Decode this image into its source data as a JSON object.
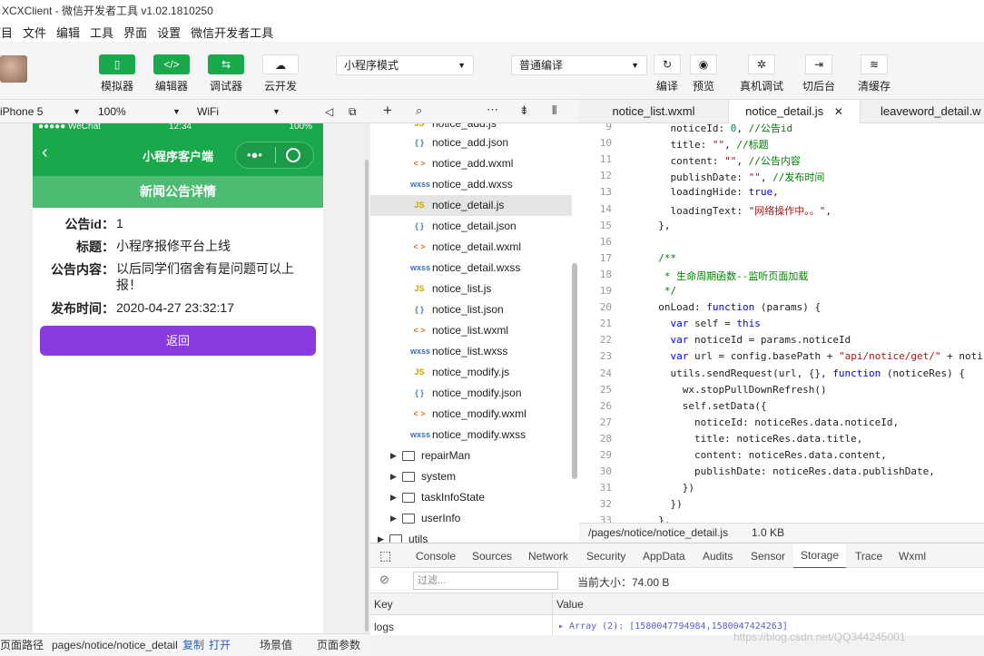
{
  "window": {
    "title": "XCXClient - 微信开发者工具 v1.02.1810250"
  },
  "menu": [
    "项目",
    "文件",
    "编辑",
    "工具",
    "界面",
    "设置",
    "微信开发者工具"
  ],
  "toolbar": {
    "simulator": "模拟器",
    "editor": "编辑器",
    "debugger": "调试器",
    "cloud": "云开发",
    "mode_select": "小程序模式",
    "compile_select": "普通编译",
    "compile": "编译",
    "preview": "预览",
    "remote_debug": "真机调试",
    "background": "切后台",
    "clear_cache": "清缓存"
  },
  "sim_bar": {
    "device": "iPhone 5",
    "zoom": "100%",
    "network": "WiFi"
  },
  "phone": {
    "status_left": "●●●●● WeChat",
    "status_time": "12:34",
    "status_right": "100%",
    "nav_title": "小程序客户端",
    "sub_title": "新闻公告详情",
    "fields": [
      {
        "k": "公告id：",
        "v": "1"
      },
      {
        "k": "标题：",
        "v": "小程序报修平台上线"
      },
      {
        "k": "公告内容：",
        "v": "以后同学们宿舍有是问题可以上报！"
      },
      {
        "k": "发布时间：",
        "v": "2020-04-27 23:32:17"
      }
    ],
    "back_button": "返回"
  },
  "files": [
    {
      "icon": "JS",
      "name": "notice_add.js",
      "color": "#c9a400"
    },
    {
      "icon": "{ }",
      "name": "notice_add.json",
      "color": "#3a7fc1"
    },
    {
      "icon": "< >",
      "name": "notice_add.wxml",
      "color": "#e0702a"
    },
    {
      "icon": "wxss",
      "name": "notice_add.wxss",
      "color": "#3a6fbf"
    },
    {
      "icon": "JS",
      "name": "notice_detail.js",
      "color": "#c9a400"
    },
    {
      "icon": "{ }",
      "name": "notice_detail.json",
      "color": "#3a7fc1"
    },
    {
      "icon": "< >",
      "name": "notice_detail.wxml",
      "color": "#e0702a"
    },
    {
      "icon": "wxss",
      "name": "notice_detail.wxss",
      "color": "#3a6fbf"
    },
    {
      "icon": "JS",
      "name": "notice_list.js",
      "color": "#c9a400"
    },
    {
      "icon": "{ }",
      "name": "notice_list.json",
      "color": "#3a7fc1"
    },
    {
      "icon": "< >",
      "name": "notice_list.wxml",
      "color": "#e0702a"
    },
    {
      "icon": "wxss",
      "name": "notice_list.wxss",
      "color": "#3a6fbf"
    },
    {
      "icon": "JS",
      "name": "notice_modify.js",
      "color": "#c9a400"
    },
    {
      "icon": "{ }",
      "name": "notice_modify.json",
      "color": "#3a7fc1"
    },
    {
      "icon": "< >",
      "name": "notice_modify.wxml",
      "color": "#e0702a"
    },
    {
      "icon": "wxss",
      "name": "notice_modify.wxss",
      "color": "#3a6fbf"
    }
  ],
  "folders": [
    "repairMan",
    "system",
    "taskInfoState",
    "userInfo",
    "utils"
  ],
  "editor_tabs": [
    "notice_list.wxml",
    "notice_detail.js",
    "leaveword_detail.w"
  ],
  "code_lines": [
    {
      "n": "9",
      "html": "    noticeId: <span class='num'>0</span>, <span class='cm'>//公告id</span>"
    },
    {
      "n": "10",
      "html": "    title: <span class='str'>\"\"</span>, <span class='cm'>//标题</span>"
    },
    {
      "n": "11",
      "html": "    content: <span class='str'>\"\"</span>, <span class='cm'>//公告内容</span>"
    },
    {
      "n": "12",
      "html": "    publishDate: <span class='str'>\"\"</span>, <span class='cm'>//发布时间</span>"
    },
    {
      "n": "13",
      "html": "    loadingHide: <span class='kw'>true</span>,"
    },
    {
      "n": "14",
      "html": "    loadingText: <span class='str'>\"网络操作中。。\"</span>,"
    },
    {
      "n": "15",
      "html": "  },"
    },
    {
      "n": "16",
      "html": ""
    },
    {
      "n": "17",
      "html": "  <span class='cm'>/**</span>"
    },
    {
      "n": "18",
      "html": "  <span class='cm'> * 生命周期函数--监听页面加载</span>"
    },
    {
      "n": "19",
      "html": "  <span class='cm'> */</span>"
    },
    {
      "n": "20",
      "html": "  onLoad: <span class='kw'>function</span> (params) {"
    },
    {
      "n": "21",
      "html": "    <span class='kw'>var</span> self = <span class='kw'>this</span>"
    },
    {
      "n": "22",
      "html": "    <span class='kw'>var</span> noticeId = params.noticeId"
    },
    {
      "n": "23",
      "html": "    <span class='kw'>var</span> url = config.basePath + <span class='str'>\"api/notice/get/\"</span> + noticeI"
    },
    {
      "n": "24",
      "html": "    utils.sendRequest(url, {}, <span class='kw'>function</span> (noticeRes) {"
    },
    {
      "n": "25",
      "html": "      wx.stopPullDownRefresh()"
    },
    {
      "n": "26",
      "html": "      self.setData({"
    },
    {
      "n": "27",
      "html": "        noticeId: noticeRes.data.noticeId,"
    },
    {
      "n": "28",
      "html": "        title: noticeRes.data.title,"
    },
    {
      "n": "29",
      "html": "        content: noticeRes.data.content,"
    },
    {
      "n": "30",
      "html": "        publishDate: noticeRes.data.publishDate,"
    },
    {
      "n": "31",
      "html": "      })"
    },
    {
      "n": "32",
      "html": "    })"
    },
    {
      "n": "33",
      "html": "  },"
    }
  ],
  "editor_status": {
    "path": "/pages/notice/notice_detail.js",
    "size": "1.0 KB"
  },
  "devtools": {
    "tabs": [
      "Console",
      "Sources",
      "Network",
      "Security",
      "AppData",
      "Audits",
      "Sensor",
      "Storage",
      "Trace",
      "Wxml"
    ],
    "active_tab": "Storage",
    "filter_placeholder": "过滤...",
    "current_size": "当前大小：74.00 B",
    "col_key": "Key",
    "col_value": "Value",
    "row_key": "logs",
    "row_value": "▸ Array (2): [1580047794984,1580047424263]"
  },
  "bottom": {
    "path_label": "页面路径",
    "path": "pages/notice/notice_detail",
    "copy": "复制",
    "open": "打开",
    "scene": "场景值",
    "params": "页面参数"
  },
  "watermark": "https://blog.csdn.net/QQ344245001"
}
